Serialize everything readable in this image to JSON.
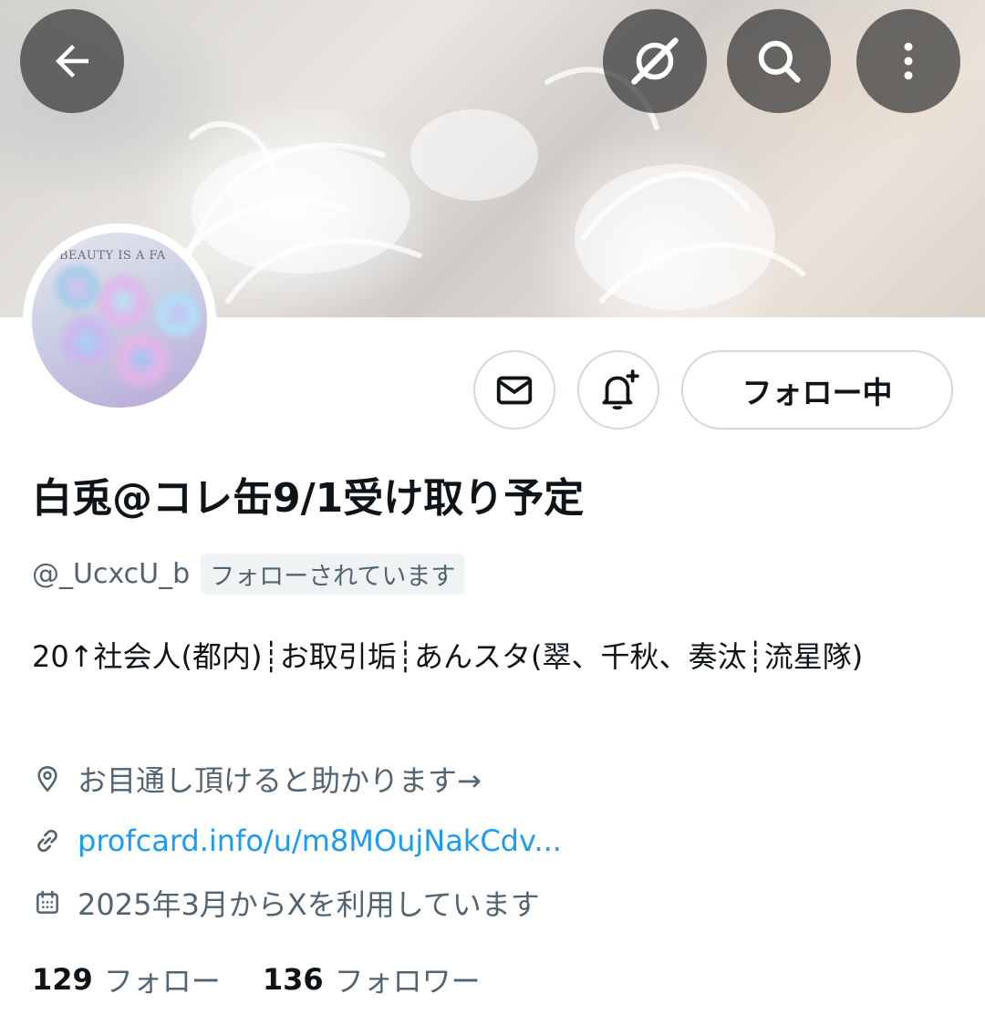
{
  "header": {
    "back_icon": "arrow-left-icon",
    "grok_icon": "grok-icon",
    "search_icon": "search-icon",
    "more_icon": "more-vertical-icon"
  },
  "avatar": {
    "caption": "BEAUTY IS A FA"
  },
  "actions": {
    "message_icon": "mail-icon",
    "notify_icon": "bell-plus-icon",
    "follow_label": "フォロー中"
  },
  "profile": {
    "display_name": "白兎@コレ缶9/1受け取り予定",
    "handle": "@_UcxcU_b",
    "follows_you": "フォローされています",
    "bio": "20↑社会人(都内)┊お取引垢┊あんスタ(翠、千秋、奏汰┊流星隊)",
    "location": "お目通し頂けると助かります→",
    "website": "profcard.info/u/m8MOujNakCdv...",
    "joined": "2025年3月からXを利用しています"
  },
  "stats": {
    "following_count": "129",
    "following_label": "フォロー",
    "followers_count": "136",
    "followers_label": "フォロワー"
  },
  "colors": {
    "text_primary": "#0f1419",
    "text_secondary": "#536471",
    "link": "#1d9bf0",
    "border": "#cfd9de"
  }
}
